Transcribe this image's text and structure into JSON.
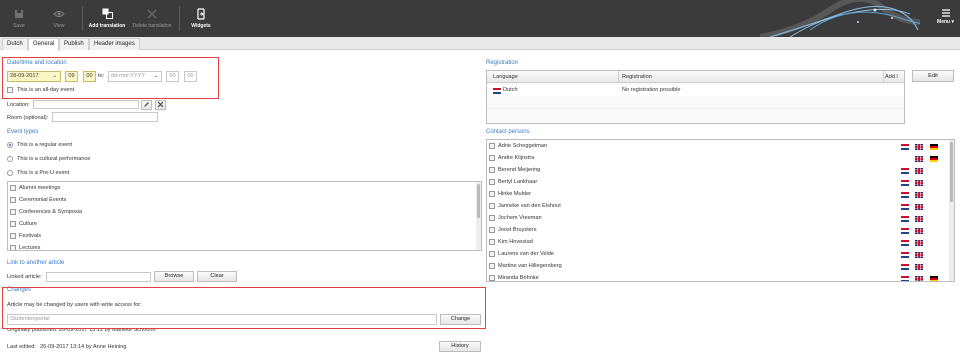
{
  "toolbar": {
    "buttons": [
      {
        "label": "Save",
        "icon": "save-icon",
        "enabled": false
      },
      {
        "label": "View",
        "icon": "eye-icon",
        "enabled": false
      },
      {
        "label": "Add translation",
        "icon": "add-translation-icon",
        "enabled": true
      },
      {
        "label": "Delete translation",
        "icon": "delete-icon",
        "enabled": false
      },
      {
        "label": "Widgets",
        "icon": "widgets-icon",
        "enabled": true
      }
    ],
    "menu_label": "Menu ▾"
  },
  "tabs": [
    "Dutch",
    "General",
    "Publish",
    "Header images"
  ],
  "active_tab": "General",
  "datetime": {
    "heading": "Date/time and location",
    "start_date": "28-09-2017",
    "start_hour": "09",
    "start_minute": "00",
    "to_label": "to:",
    "end_date_placeholder": "dd-mm-YYYY",
    "end_hour": "00",
    "end_minute": "00",
    "allday_label": "This is an all-day event",
    "location_label": "Location:",
    "room_label": "Room (optional):"
  },
  "event_types": {
    "heading": "Event types",
    "radios": [
      "This is a regular event",
      "This is a cultural performance",
      "This is a Pre-U event"
    ],
    "selected_radio": 0,
    "categories": [
      "Alumni meetings",
      "Ceremonial Events",
      "Conferences & Symposia",
      "Culture",
      "Festivals",
      "Lectures"
    ]
  },
  "link": {
    "heading": "Link to another article",
    "label": "Linked article:",
    "browse": "Browse",
    "clear": "Clear"
  },
  "changes": {
    "heading": "Changes",
    "text": "Article may be changed by users with write access for:",
    "value": "Studentenportal",
    "button": "Change",
    "published": "Originally published: 26-09-2017 13:12 by Marieke Schoonn",
    "edited_label": "Last edited:",
    "edited_value": "26-09-2017 13:14 by Anne Heining",
    "history": "History"
  },
  "registration": {
    "heading": "Registration",
    "columns": [
      "Language",
      "Registration",
      "Add l"
    ],
    "rows": [
      {
        "language": "Dutch",
        "registration": "No registration possible"
      }
    ],
    "edit_button": "Edit"
  },
  "contacts": {
    "heading": "Contact persons",
    "people": [
      {
        "name": "Adrie Scheggetman",
        "flags": [
          "nl",
          "uk",
          "de"
        ]
      },
      {
        "name": "Andre Klijnstra",
        "flags": [
          "uk",
          "de"
        ]
      },
      {
        "name": "Berend Meijering",
        "flags": [
          "nl",
          "uk"
        ]
      },
      {
        "name": "Bertyl Lankhaar",
        "flags": [
          "nl",
          "uk"
        ]
      },
      {
        "name": "Hinke Mulder",
        "flags": [
          "nl",
          "uk"
        ]
      },
      {
        "name": "Janneke van den Elshout",
        "flags": [
          "nl",
          "uk"
        ]
      },
      {
        "name": "Jochem Vreeman",
        "flags": [
          "nl",
          "uk"
        ]
      },
      {
        "name": "Joost Bruysters",
        "flags": [
          "nl",
          "uk"
        ]
      },
      {
        "name": "Kim Hovestad",
        "flags": [
          "nl",
          "uk"
        ]
      },
      {
        "name": "Laurens van der Velde",
        "flags": [
          "nl",
          "uk"
        ]
      },
      {
        "name": "Martine van Hillegersberg",
        "flags": [
          "nl",
          "uk"
        ]
      },
      {
        "name": "Miranda Böhnke",
        "flags": [
          "nl",
          "uk",
          "de"
        ]
      }
    ]
  },
  "colors": {
    "accent": "#3a7bc8",
    "toolbar": "#3b3b3b",
    "highlight": "#e04040",
    "date_field": "#fdf6c6"
  }
}
